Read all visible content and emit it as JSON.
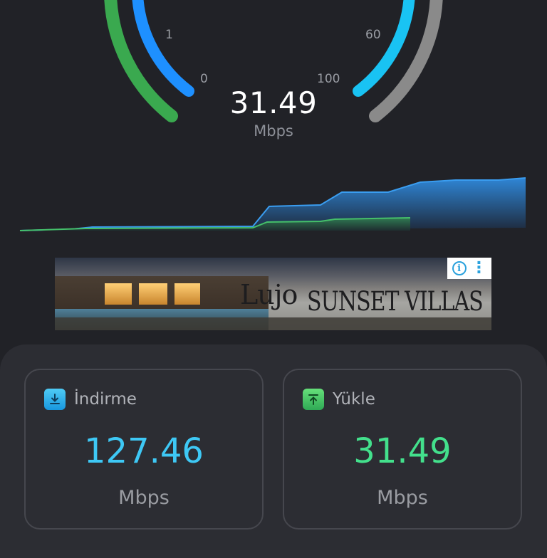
{
  "gauge": {
    "ticks": [
      "1",
      "0",
      "60",
      "100"
    ],
    "current_speed": "31.49",
    "unit": "Mbps"
  },
  "ad": {
    "brand": "Lujo",
    "title": "SUNSET VILLAS",
    "info_icon": "info-icon",
    "more_icon": "more-vertical-icon"
  },
  "results": {
    "download": {
      "label": "İndirme",
      "value": "127.46",
      "unit": "Mbps",
      "icon": "download-icon",
      "color": "#3ec8f5"
    },
    "upload": {
      "label": "Yükle",
      "value": "31.49",
      "unit": "Mbps",
      "icon": "upload-icon",
      "color": "#43e08c"
    }
  },
  "colors": {
    "background": "#212227",
    "panel": "#2c2d33",
    "blue": "#1e90ff",
    "cyan": "#19c3f3",
    "green": "#3aa94f",
    "gray": "#8a8a8a"
  }
}
